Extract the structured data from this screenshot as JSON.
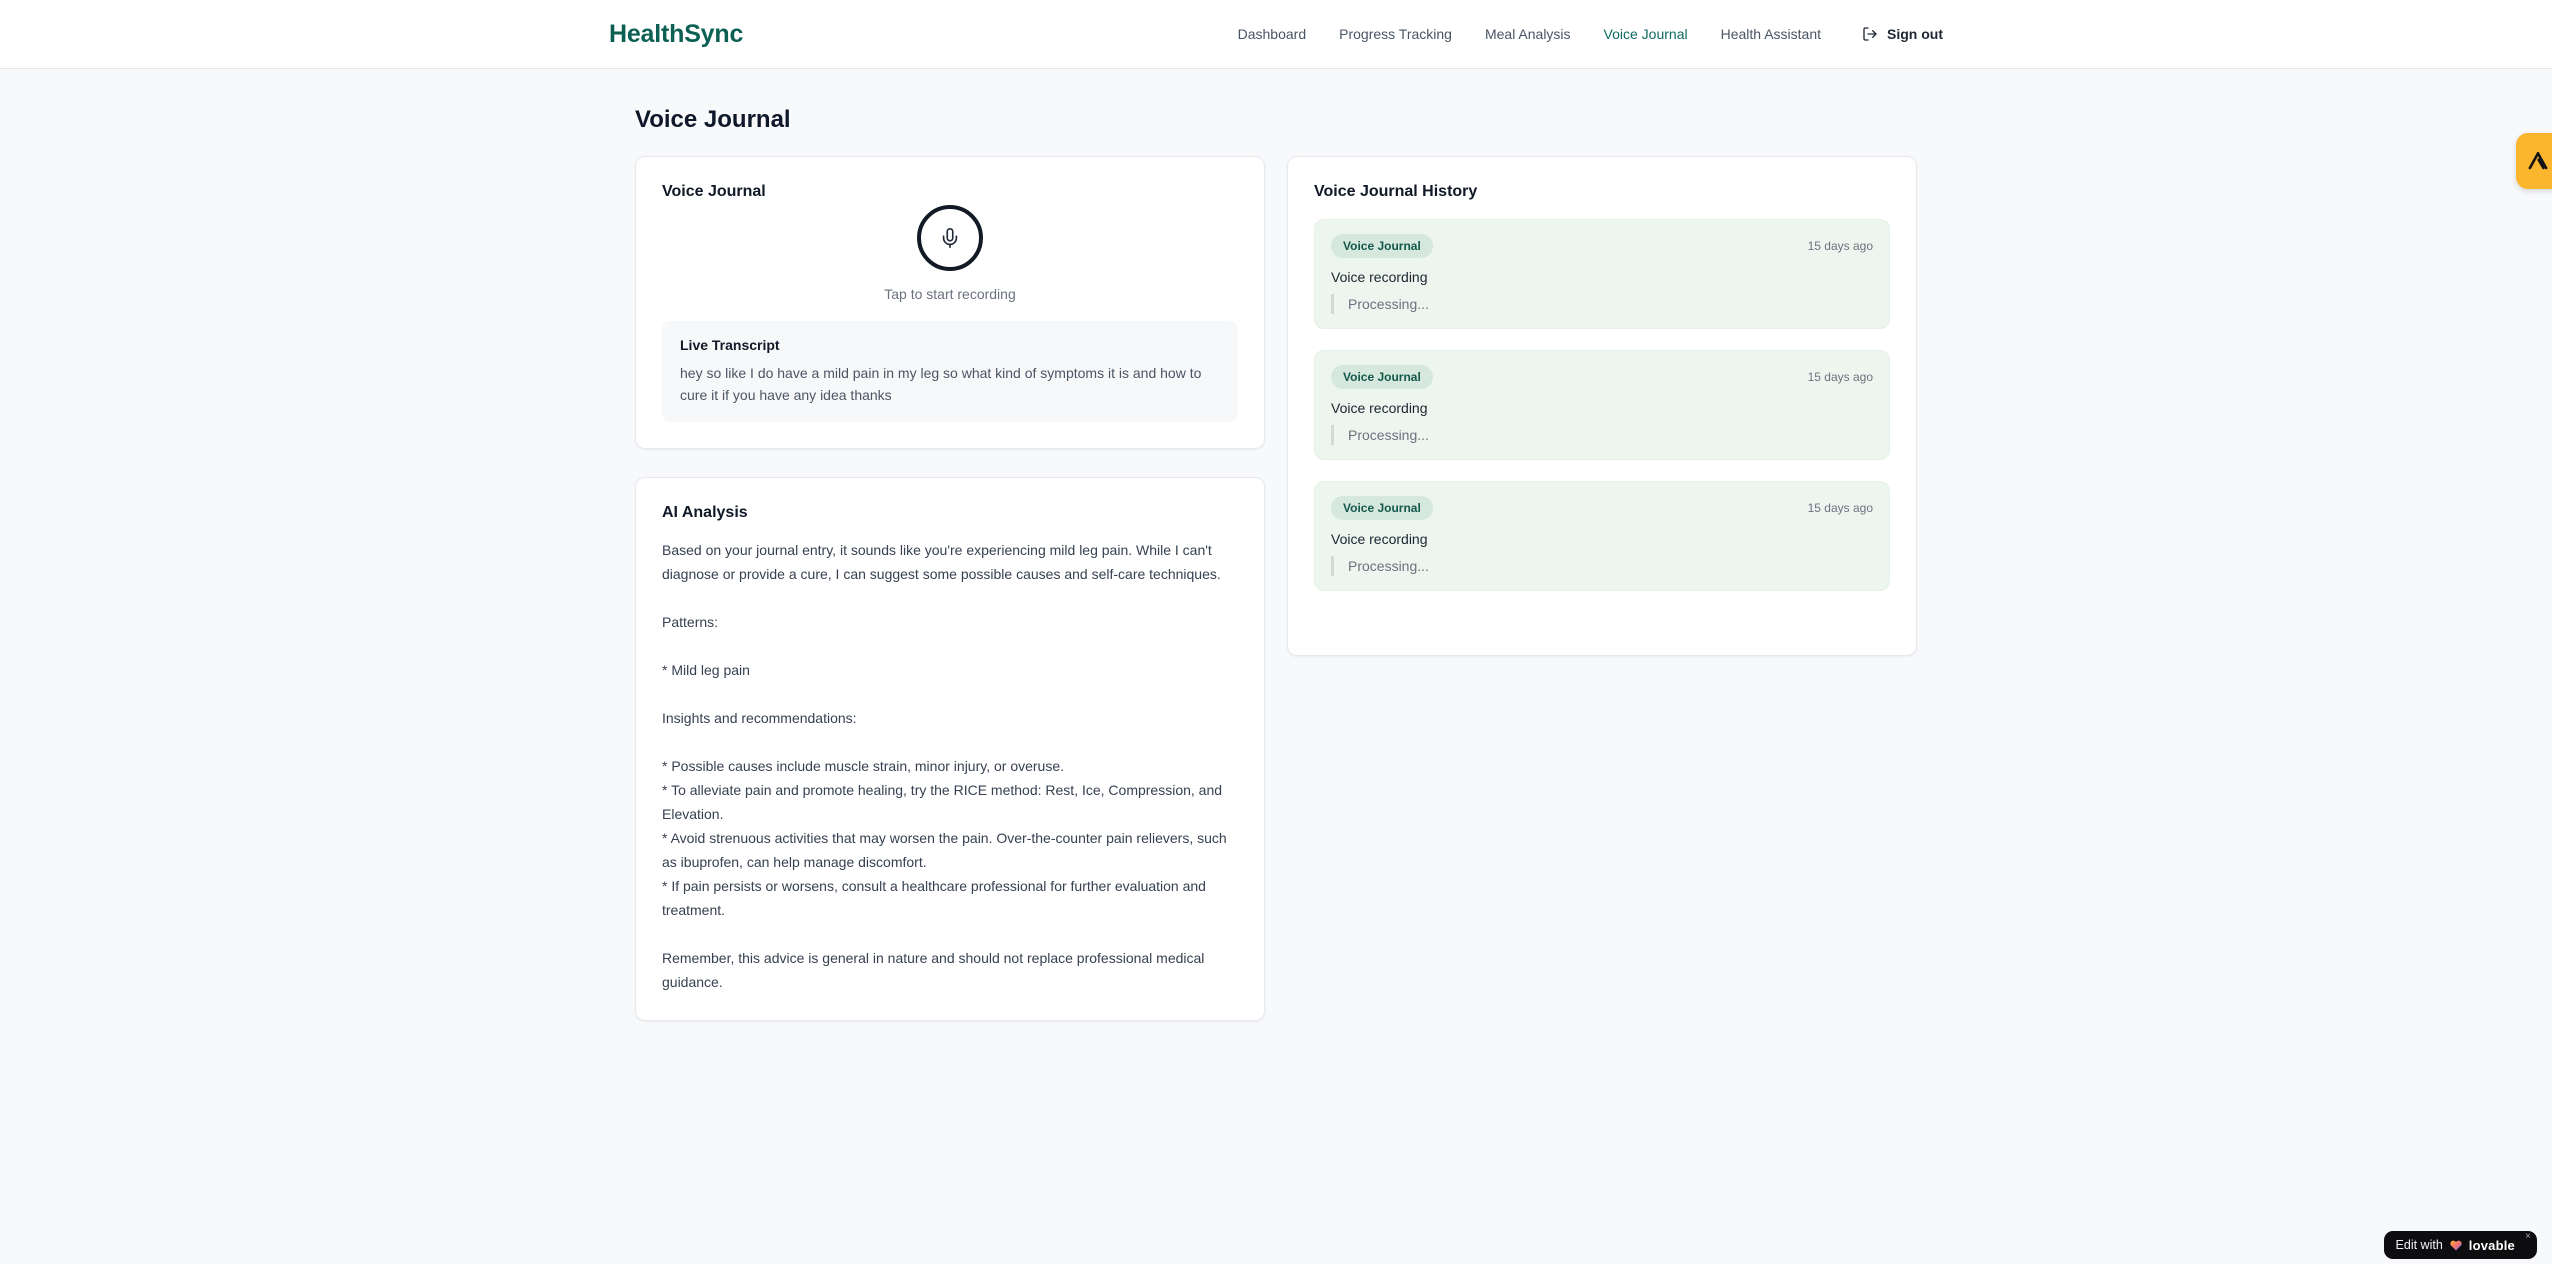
{
  "brand": {
    "name": "HealthSync",
    "color": "#0c5f53"
  },
  "nav": {
    "items": [
      {
        "label": "Dashboard",
        "active": false
      },
      {
        "label": "Progress Tracking",
        "active": false
      },
      {
        "label": "Meal Analysis",
        "active": false
      },
      {
        "label": "Voice Journal",
        "active": true
      },
      {
        "label": "Health Assistant",
        "active": false
      }
    ],
    "sign_out_label": "Sign out"
  },
  "page": {
    "title": "Voice Journal"
  },
  "recorder_card": {
    "title": "Voice Journal",
    "tap_hint": "Tap to start recording",
    "transcript_label": "Live Transcript",
    "transcript_text": "hey so like I do have a mild pain in my leg so what kind of symptoms it is and how to cure it if you have any idea thanks"
  },
  "analysis_card": {
    "title": "AI Analysis",
    "body": "Based on your journal entry, it sounds like you're experiencing mild leg pain. While I can't diagnose or provide a cure, I can suggest some possible causes and self-care techniques.\n\nPatterns:\n\n* Mild leg pain\n\nInsights and recommendations:\n\n* Possible causes include muscle strain, minor injury, or overuse.\n* To alleviate pain and promote healing, try the RICE method: Rest, Ice, Compression, and Elevation.\n* Avoid strenuous activities that may worsen the pain. Over-the-counter pain relievers, such as ibuprofen, can help manage discomfort.\n* If pain persists or worsens, consult a healthcare professional for further evaluation and treatment.\n\nRemember, this advice is general in nature and should not replace professional medical guidance."
  },
  "history_card": {
    "title": "Voice Journal History",
    "entries": [
      {
        "badge": "Voice Journal",
        "time": "15 days ago",
        "title": "Voice recording",
        "status": "Processing..."
      },
      {
        "badge": "Voice Journal",
        "time": "15 days ago",
        "title": "Voice recording",
        "status": "Processing..."
      },
      {
        "badge": "Voice Journal",
        "time": "15 days ago",
        "title": "Voice recording",
        "status": "Processing..."
      }
    ],
    "entry_bg": "#edf6ee",
    "badge_bg": "#d6e8dd",
    "badge_color": "#14584c"
  },
  "widgets": {
    "side_badge_color": "#fbb62d",
    "edit_prefix": "Edit with",
    "edit_brand": "lovable",
    "close": "×"
  }
}
